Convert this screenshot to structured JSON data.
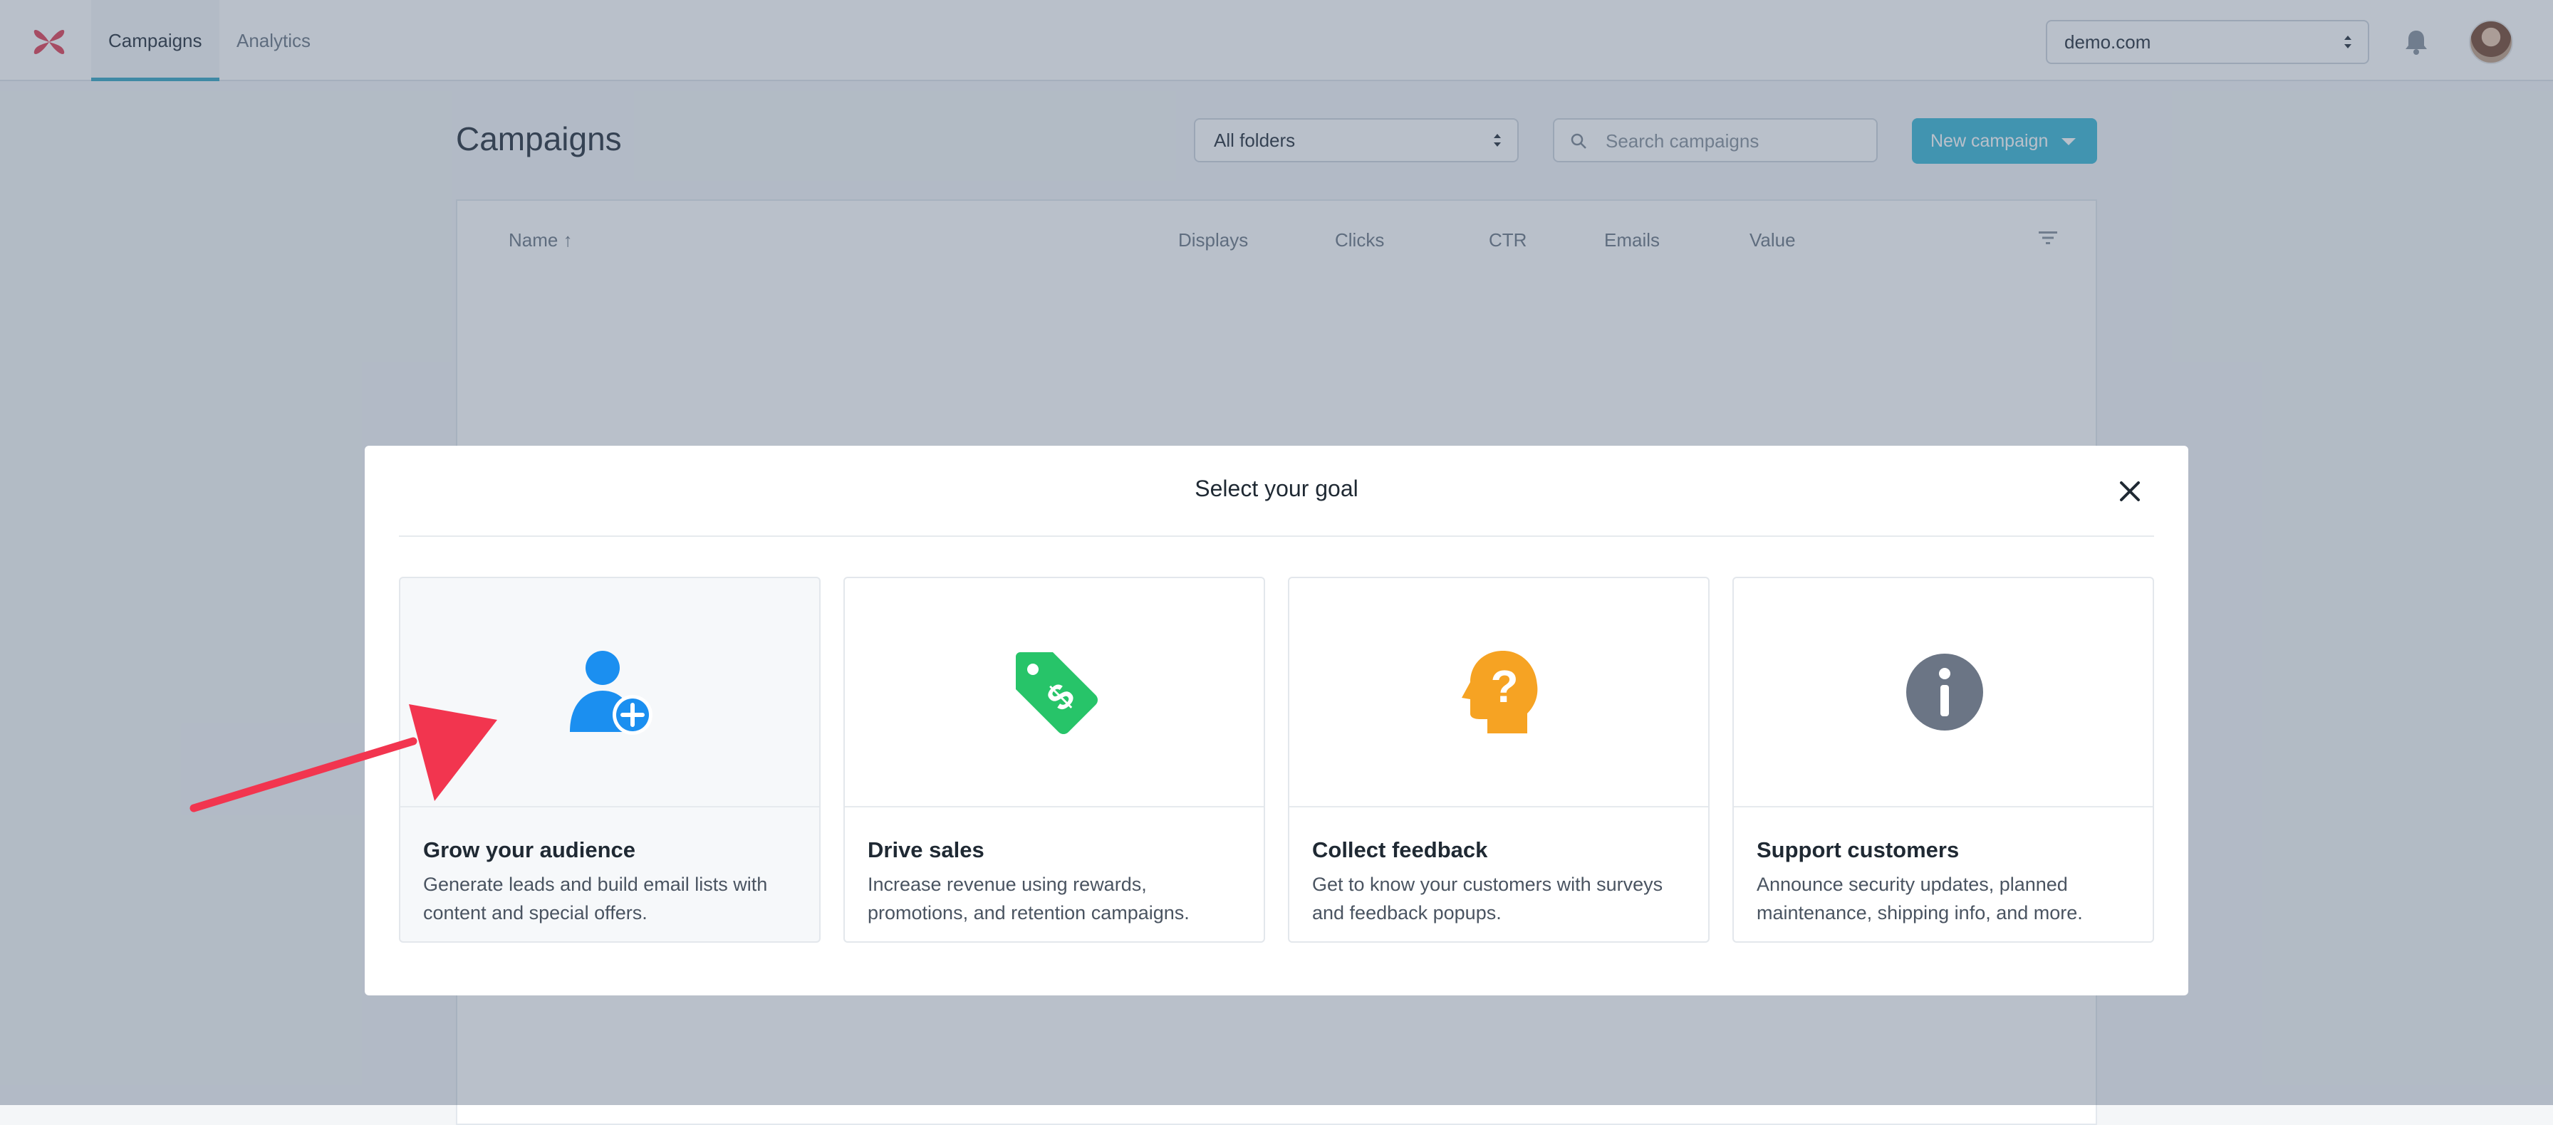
{
  "nav": {
    "tabs": [
      {
        "label": "Campaigns",
        "active": true
      },
      {
        "label": "Analytics",
        "active": false
      }
    ],
    "site_select": "demo.com",
    "icons": {
      "logo": "app-logo",
      "notifications": "bell-icon",
      "avatar": "user-avatar"
    }
  },
  "page": {
    "title": "Campaigns",
    "folder_select": "All folders",
    "search_placeholder": "Search campaigns",
    "new_campaign_label": "New campaign",
    "accent_color": "#3eb8d6"
  },
  "table": {
    "columns": [
      "Name ↑",
      "Displays",
      "Clicks",
      "CTR",
      "Emails",
      "Value"
    ]
  },
  "modal": {
    "title": "Select your goal",
    "goals": [
      {
        "title": "Grow your audience",
        "description": "Generate leads and build email lists with content and special offers.",
        "icon": "user-plus-icon",
        "color": "#1b8ff0",
        "selected": true
      },
      {
        "title": "Drive sales",
        "description": "Increase revenue using rewards, promotions, and retention campaigns.",
        "icon": "price-tag-icon",
        "color": "#27c469",
        "selected": false
      },
      {
        "title": "Collect feedback",
        "description": "Get to know your customers with surveys and feedback popups.",
        "icon": "head-question-icon",
        "color": "#f6a323",
        "selected": false
      },
      {
        "title": "Support customers",
        "description": "Announce security updates, planned maintenance, shipping info, and more.",
        "icon": "info-icon",
        "color": "#6b7585",
        "selected": false
      }
    ]
  },
  "annotation": {
    "pointer": "red-arrow",
    "color": "#f2354f"
  }
}
